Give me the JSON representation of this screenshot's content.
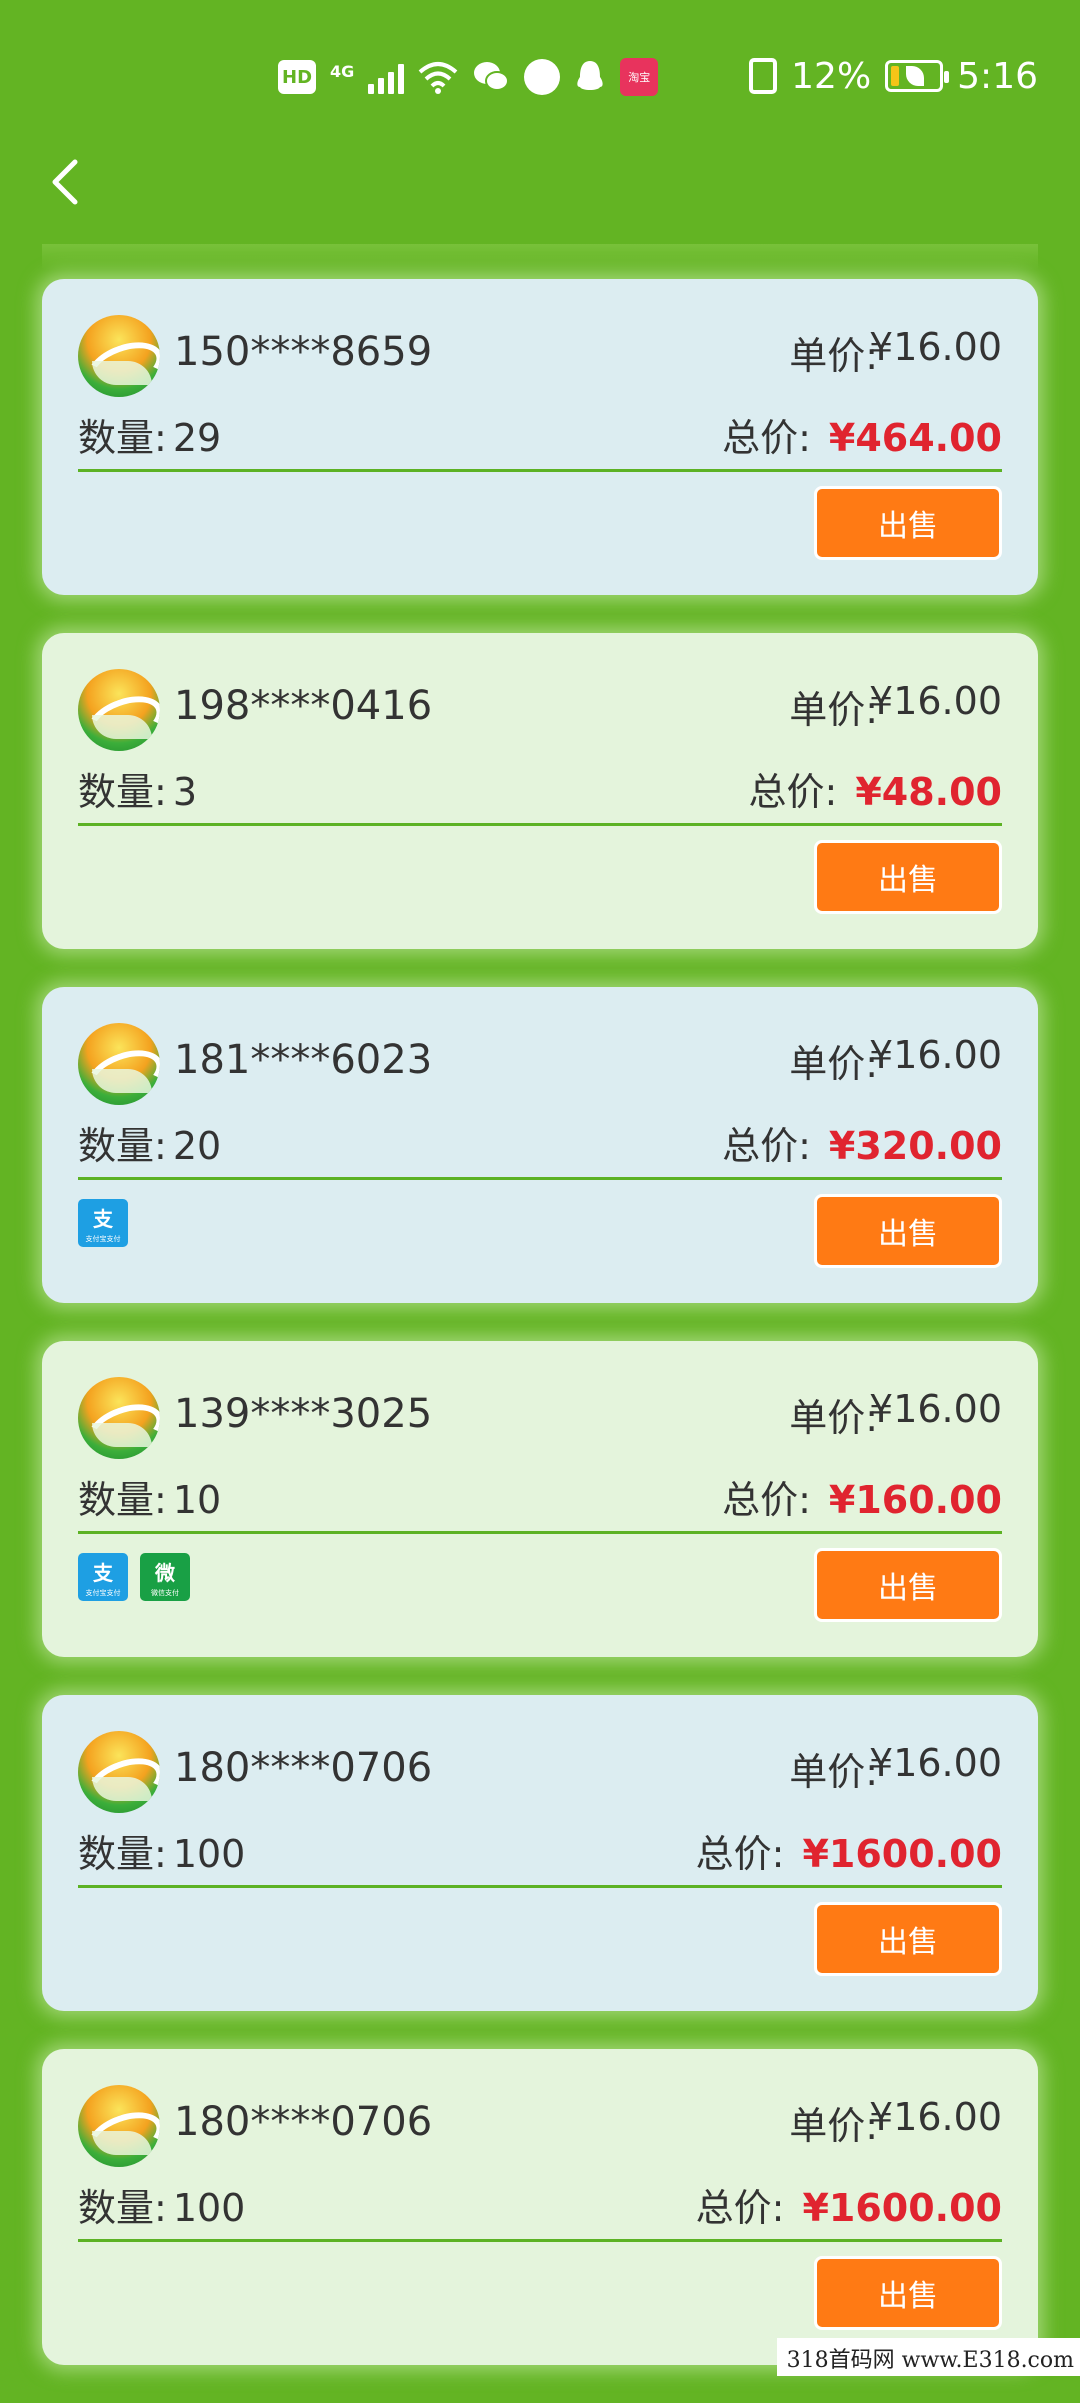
{
  "status_bar": {
    "hd": "HD",
    "network": "4G",
    "app_badge": "淘宝",
    "battery_percent": "12%",
    "time": "5:16"
  },
  "orders": [
    {
      "phone": "150****8659",
      "unit_label": "单价:",
      "unit_price": "¥16.00",
      "qty_label": "数量:",
      "qty": "29",
      "total_label": "总价:",
      "total": "¥464.00",
      "sell": "出售",
      "payments": [],
      "theme": "blue"
    },
    {
      "phone": "198****0416",
      "unit_label": "单价:",
      "unit_price": "¥16.00",
      "qty_label": "数量:",
      "qty": "3",
      "total_label": "总价:",
      "total": "¥48.00",
      "sell": "出售",
      "payments": [],
      "theme": "green"
    },
    {
      "phone": "181****6023",
      "unit_label": "单价:",
      "unit_price": "¥16.00",
      "qty_label": "数量:",
      "qty": "20",
      "total_label": "总价:",
      "total": "¥320.00",
      "sell": "出售",
      "payments": [
        "alipay"
      ],
      "theme": "blue"
    },
    {
      "phone": "139****3025",
      "unit_label": "单价:",
      "unit_price": "¥16.00",
      "qty_label": "数量:",
      "qty": "10",
      "total_label": "总价:",
      "total": "¥160.00",
      "sell": "出售",
      "payments": [
        "alipay",
        "wechat"
      ],
      "theme": "green"
    },
    {
      "phone": "180****0706",
      "unit_label": "单价:",
      "unit_price": "¥16.00",
      "qty_label": "数量:",
      "qty": "100",
      "total_label": "总价:",
      "total": "¥1600.00",
      "sell": "出售",
      "payments": [],
      "theme": "blue"
    },
    {
      "phone": "180****0706",
      "unit_label": "单价:",
      "unit_price": "¥16.00",
      "qty_label": "数量:",
      "qty": "100",
      "total_label": "总价:",
      "total": "¥1600.00",
      "sell": "出售",
      "payments": [],
      "theme": "green"
    }
  ],
  "payment_labels": {
    "alipay": {
      "glyph": "支",
      "caption": "支付宝支付"
    },
    "wechat": {
      "glyph": "微",
      "caption": "微信支付"
    }
  },
  "watermark": "318首码网 www.E318.com",
  "colors": {
    "background": "#63b423",
    "card_blue": "#dcedf1",
    "card_green": "#e4f4dc",
    "sell_button": "#ff7a14",
    "total_price": "#e0242f"
  }
}
